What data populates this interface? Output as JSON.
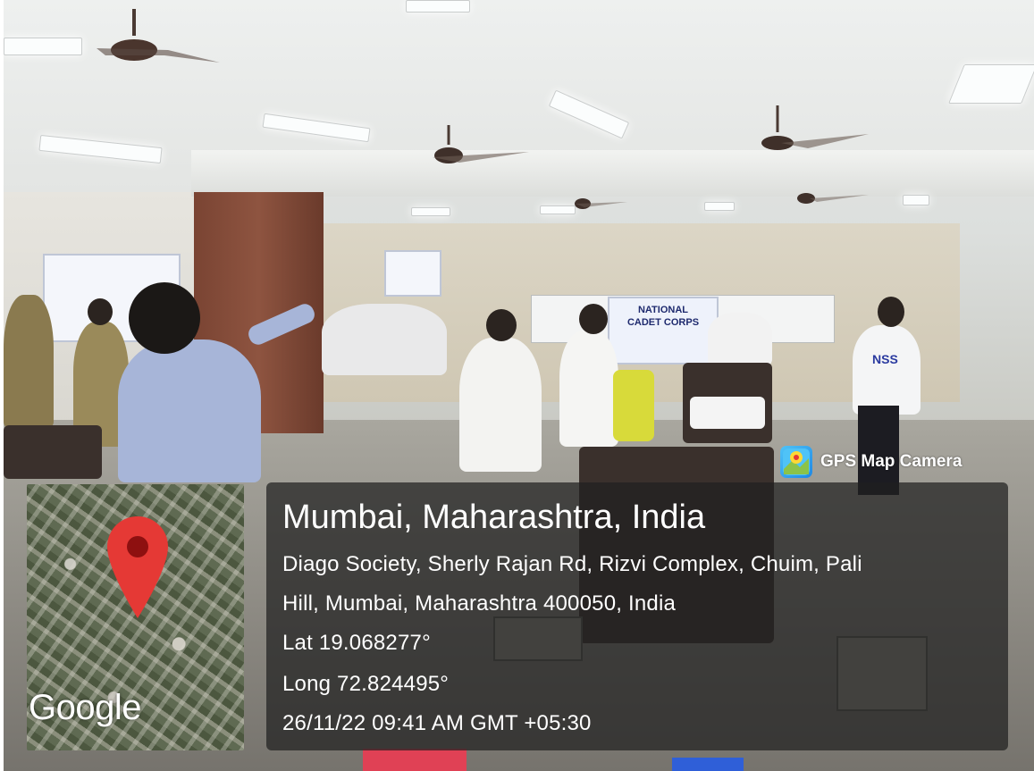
{
  "overlay": {
    "app_label": "GPS Map Camera",
    "location_title": "Mumbai, Maharashtra, India",
    "address_line_1": "Diago Society, Sherly Rajan Rd, Rizvi Complex, Chuim, Pali",
    "address_line_2": "Hill, Mumbai, Maharashtra 400050, India",
    "latitude": "Lat 19.068277°",
    "longitude": "Long 72.824495°",
    "timestamp": "26/11/22 09:41 AM GMT +05:30",
    "map_brand": "Google",
    "pin_color": "#e53935",
    "panel_color": "#202020"
  },
  "scene": {
    "banner_text": [
      "NATIONAL",
      "CADET CORPS"
    ],
    "shirt_text": "NSS"
  }
}
